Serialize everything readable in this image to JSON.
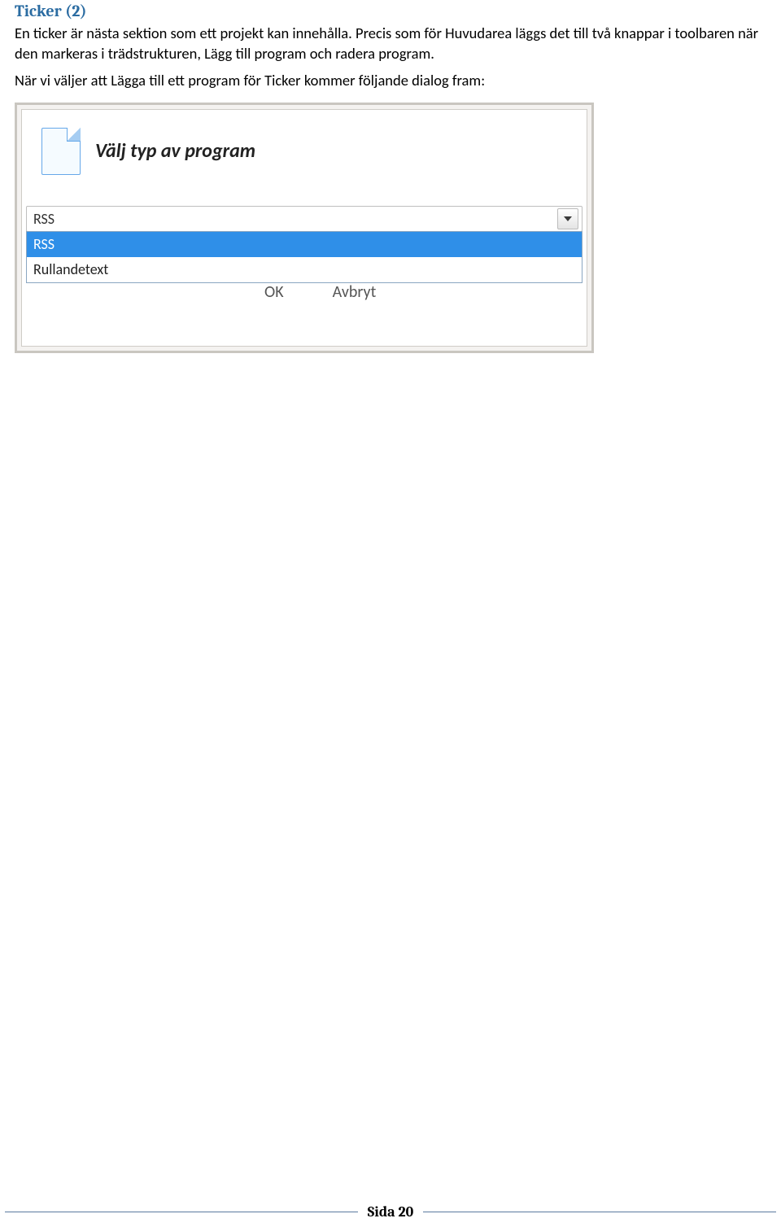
{
  "heading": "Ticker (2)",
  "para1": "En ticker är nästa sektion som ett projekt kan innehålla. Precis som för Huvudarea läggs det till två knappar i toolbaren när den markeras i trädstrukturen, Lägg till program och radera program.",
  "para2": "När vi väljer att Lägga till ett program för Ticker kommer följande dialog fram:",
  "dialog": {
    "title": "Välj typ av program",
    "combo_value": "RSS",
    "options": [
      "RSS",
      "Rullandetext"
    ],
    "ok_label": "OK",
    "cancel_label": "Avbryt"
  },
  "footer": "Sida 20"
}
